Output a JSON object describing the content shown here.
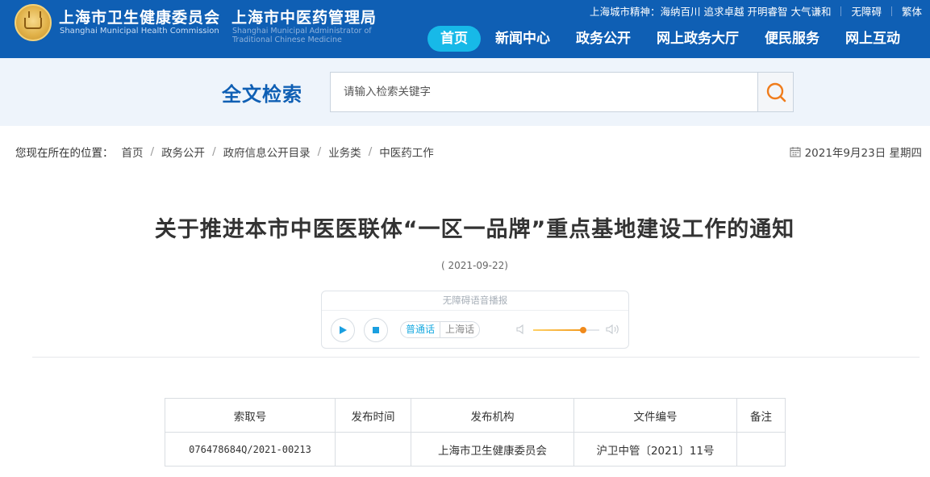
{
  "header": {
    "org_cn": "上海市卫生健康委员会",
    "org_en": "Shanghai Municipal Health Commission",
    "org2_cn": "上海市中医药管理局",
    "org2_en": "Shanghai Municipal Administrator of Traditional Chinese Medicine",
    "motto": "上海城市精神：海纳百川 追求卓越 开明睿智 大气谦和",
    "accessibility": "无障碍",
    "traditional": "繁体",
    "nav": [
      "首页",
      "新闻中心",
      "政务公开",
      "网上政务大厅",
      "便民服务",
      "网上互动"
    ]
  },
  "search": {
    "title": "全文检索",
    "placeholder": "请输入检索关键字"
  },
  "breadcrumb": {
    "label": "您现在所在的位置：",
    "items": [
      "首页",
      "政务公开",
      "政府信息公开目录",
      "业务类",
      "中医药工作"
    ]
  },
  "today": "2021年9月23日 星期四",
  "article": {
    "title": "关于推进本市中医医联体“一区一品牌”重点基地建设工作的通知",
    "date": "( 2021-09-22)"
  },
  "audio": {
    "title": "无障碍语音播报",
    "lang_mandarin": "普通话",
    "lang_shanghai": "上海话",
    "volume": 0.75
  },
  "table": {
    "headers": [
      "索取号",
      "发布时间",
      "发布机构",
      "文件编号",
      "备注"
    ],
    "rows": [
      [
        "076478684Q/2021-00213",
        "",
        "上海市卫生健康委员会",
        "沪卫中管〔2021〕11号",
        ""
      ]
    ]
  },
  "colors": {
    "brand_blue": "#0f5fb4",
    "nav_active": "#17b9e8",
    "search_band": "#eef4fb"
  }
}
